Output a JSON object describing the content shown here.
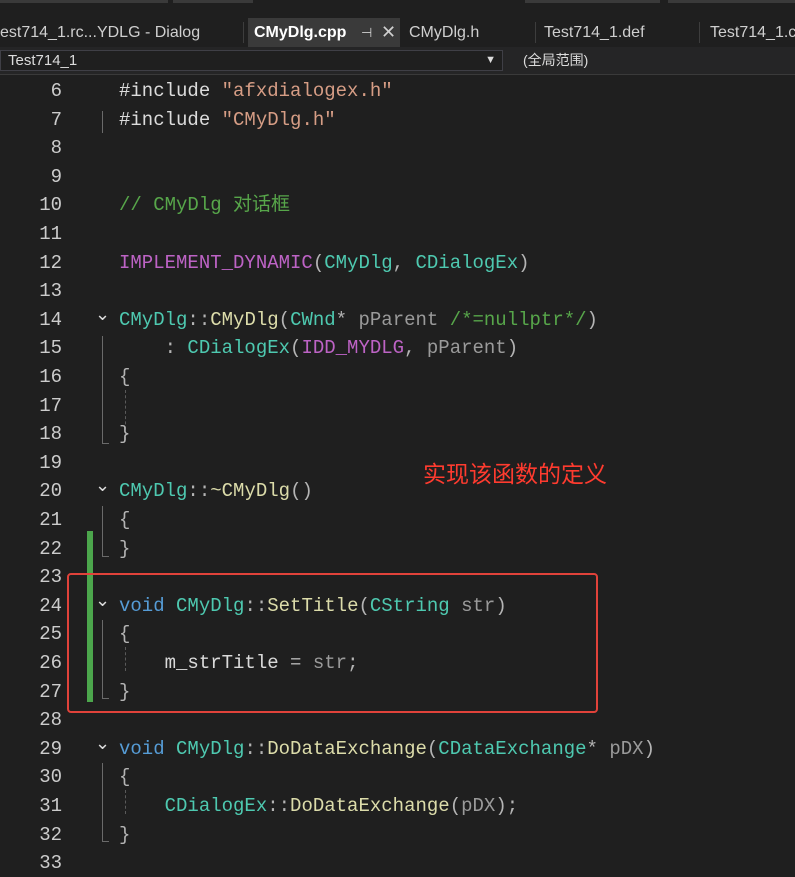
{
  "tabs": [
    {
      "label": "est714_1.rc...YDLG - Dialog",
      "active": false
    },
    {
      "label": "CMyDlg.cpp",
      "active": true
    },
    {
      "label": "CMyDlg.h",
      "active": false
    },
    {
      "label": "Test714_1.def",
      "active": false
    },
    {
      "label": "Test714_1.c",
      "active": false
    }
  ],
  "nav": {
    "project": "Test714_1",
    "scope": "(全局范围)"
  },
  "lines": [
    {
      "n": "6",
      "code": [
        [
          "pl",
          "#include "
        ],
        [
          "str",
          "\"afxdialogex.h\""
        ]
      ]
    },
    {
      "n": "7",
      "code": [
        [
          "pl",
          "#include "
        ],
        [
          "str",
          "\"CMyDlg.h\""
        ]
      ]
    },
    {
      "n": "8",
      "code": []
    },
    {
      "n": "9",
      "code": []
    },
    {
      "n": "10",
      "code": [
        [
          "cmt",
          "// CMyDlg 对话框"
        ]
      ]
    },
    {
      "n": "11",
      "code": []
    },
    {
      "n": "12",
      "code": [
        [
          "mac",
          "IMPLEMENT_DYNAMIC"
        ],
        [
          "pun",
          "("
        ],
        [
          "typ",
          "CMyDlg"
        ],
        [
          "pun",
          ", "
        ],
        [
          "typ",
          "CDialogEx"
        ],
        [
          "pun",
          ")"
        ]
      ]
    },
    {
      "n": "13",
      "code": []
    },
    {
      "n": "14",
      "code": [
        [
          "typ",
          "CMyDlg"
        ],
        [
          "pun",
          "::"
        ],
        [
          "fn",
          "CMyDlg"
        ],
        [
          "pun",
          "("
        ],
        [
          "typ",
          "CWnd"
        ],
        [
          "pun",
          "* "
        ],
        [
          "par",
          "pParent "
        ],
        [
          "cmt",
          "/*=nullptr*/"
        ],
        [
          "pun",
          ")"
        ]
      ]
    },
    {
      "n": "15",
      "code": [
        [
          "pun",
          "    : "
        ],
        [
          "typ",
          "CDialogEx"
        ],
        [
          "pun",
          "("
        ],
        [
          "mac",
          "IDD_MYDLG"
        ],
        [
          "pun",
          ", "
        ],
        [
          "par",
          "pParent"
        ],
        [
          "pun",
          ")"
        ]
      ]
    },
    {
      "n": "16",
      "code": [
        [
          "pun",
          "{"
        ]
      ]
    },
    {
      "n": "17",
      "code": []
    },
    {
      "n": "18",
      "code": [
        [
          "pun",
          "}"
        ]
      ]
    },
    {
      "n": "19",
      "code": []
    },
    {
      "n": "20",
      "code": [
        [
          "typ",
          "CMyDlg"
        ],
        [
          "pun",
          "::"
        ],
        [
          "fn",
          "~CMyDlg"
        ],
        [
          "pun",
          "()"
        ]
      ]
    },
    {
      "n": "21",
      "code": [
        [
          "pun",
          "{"
        ]
      ]
    },
    {
      "n": "22",
      "code": [
        [
          "pun",
          "}"
        ]
      ]
    },
    {
      "n": "23",
      "code": []
    },
    {
      "n": "24",
      "code": [
        [
          "kw",
          "void "
        ],
        [
          "typ",
          "CMyDlg"
        ],
        [
          "pun",
          "::"
        ],
        [
          "fn",
          "SetTitle"
        ],
        [
          "pun",
          "("
        ],
        [
          "typ",
          "CString "
        ],
        [
          "par",
          "str"
        ],
        [
          "pun",
          ")"
        ]
      ]
    },
    {
      "n": "25",
      "code": [
        [
          "pun",
          "{"
        ]
      ]
    },
    {
      "n": "26",
      "code": [
        [
          "pun",
          "    "
        ],
        [
          "mem",
          "m_strTitle"
        ],
        [
          "pun",
          " = "
        ],
        [
          "par",
          "str"
        ],
        [
          "pun",
          ";"
        ]
      ]
    },
    {
      "n": "27",
      "code": [
        [
          "pun",
          "}"
        ]
      ]
    },
    {
      "n": "28",
      "code": []
    },
    {
      "n": "29",
      "code": [
        [
          "kw",
          "void "
        ],
        [
          "typ",
          "CMyDlg"
        ],
        [
          "pun",
          "::"
        ],
        [
          "fn",
          "DoDataExchange"
        ],
        [
          "pun",
          "("
        ],
        [
          "typ",
          "CDataExchange"
        ],
        [
          "pun",
          "* "
        ],
        [
          "par",
          "pDX"
        ],
        [
          "pun",
          ")"
        ]
      ]
    },
    {
      "n": "30",
      "code": [
        [
          "pun",
          "{"
        ]
      ]
    },
    {
      "n": "31",
      "code": [
        [
          "pun",
          "    "
        ],
        [
          "typ",
          "CDialogEx"
        ],
        [
          "pun",
          "::"
        ],
        [
          "fn",
          "DoDataExchange"
        ],
        [
          "pun",
          "("
        ],
        [
          "par",
          "pDX"
        ],
        [
          "pun",
          ");"
        ]
      ]
    },
    {
      "n": "32",
      "code": [
        [
          "pun",
          "}"
        ]
      ]
    },
    {
      "n": "33",
      "code": []
    }
  ],
  "annotation": {
    "text": "实现该函数的定义",
    "color": "#e0423a"
  },
  "colors": {
    "keyword": "#569cd6",
    "string": "#d69d85",
    "comment": "#57a64a",
    "type": "#4ec9b0",
    "function": "#dcdcaa",
    "macro": "#bd63c5",
    "change_bar": "#4ca64c"
  },
  "icons": {
    "pin": "pin-icon",
    "close": "close-icon",
    "dropdown": "chevron-down-icon",
    "fold": "collapse-chevron-icon"
  }
}
